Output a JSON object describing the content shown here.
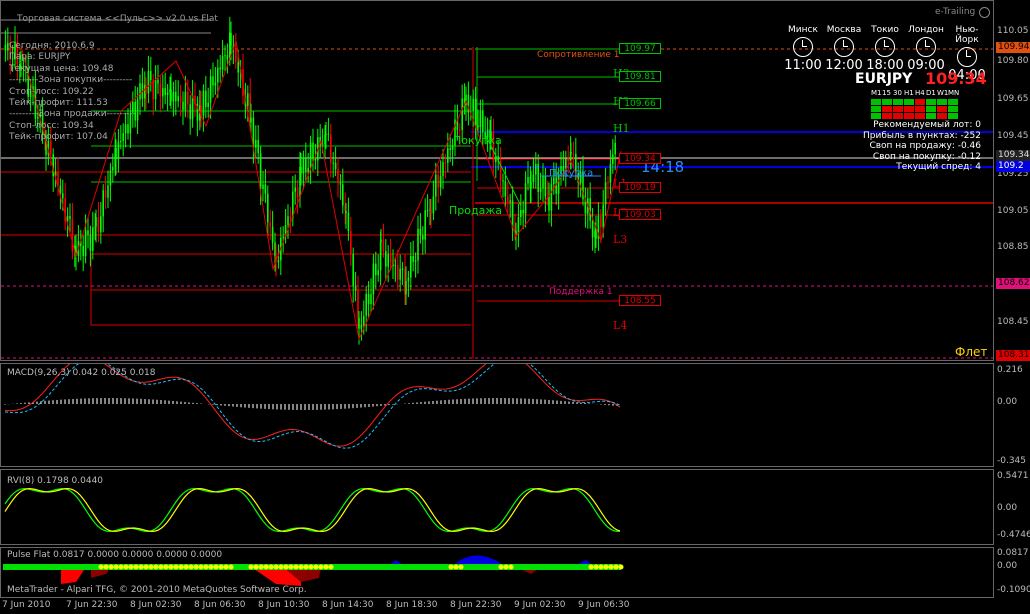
{
  "window": {
    "title": "Торговая система <<Пульс>> v2.0 vs Flat",
    "corner_label": "e-Trailing"
  },
  "info_lines": [
    "Сегодня: 2010.6.9",
    "Пара:  EURJPY",
    "Текущая цена: 109.48",
    "---------Зона покупки---------",
    "Стоп-лосс:     109.22",
    "Тейк-профит:   111.53",
    "---------Зона продажи---------",
    "Стоп-лосс:     109.34",
    "Тейк-профит:   107.04"
  ],
  "clocks": [
    {
      "city": "Минск",
      "time": "11:00"
    },
    {
      "city": "Москва",
      "time": "12:00"
    },
    {
      "city": "Токио",
      "time": "18:00"
    },
    {
      "city": "Лондон",
      "time": "09:00"
    },
    {
      "city": "Нью-Йорк",
      "time": "04:00"
    }
  ],
  "symbol": {
    "name": "EURJPY",
    "price": "109.34"
  },
  "timeframes": [
    "M1",
    "15",
    "30",
    "H1",
    "H4",
    "D1",
    "W1",
    "MN"
  ],
  "tf_status": [
    [
      "#00c000",
      "#00c000",
      "#00c000",
      "#00c000",
      "#e00000",
      "#00c000",
      "#00c000",
      "#00c000"
    ],
    [
      "#00c000",
      "#e00000",
      "#e00000",
      "#e00000",
      "#e00000",
      "#00c000",
      "#e00000",
      "#00c000"
    ],
    [
      "#00c000",
      "#e00000",
      "#e00000",
      "#e00000",
      "#e00000",
      "#00c000",
      "#e00000",
      "#00c000"
    ]
  ],
  "stats": [
    "Рекомендуемый лот: 0",
    "Прибыль в пунктах: -252",
    "Своп на продажу: -0.46",
    "Своп на покупку: -0.12",
    "Текущий спред: 4"
  ],
  "levels": [
    {
      "label": "H3",
      "price": "109.97",
      "color": "#00c000"
    },
    {
      "label": "H2",
      "price": "109.81",
      "color": "#00c000"
    },
    {
      "label": "H1",
      "price": "109.66",
      "color": "#00c000"
    },
    {
      "label": "L1",
      "price": "109.34",
      "color": "#e00000"
    },
    {
      "label": "L2",
      "price": "109.19",
      "color": "#e00000"
    },
    {
      "label": "L3",
      "price": "109.03",
      "color": "#e00000"
    },
    {
      "label": "L4",
      "price": "108.55",
      "color": "#e00000"
    }
  ],
  "zone_labels": {
    "resistance": "Сопротивление 1",
    "support": "Поддержка 1",
    "sell": "Продажа",
    "buy": "Покупка",
    "buy2": "Покупка",
    "flat": "Флет",
    "countdown": "14:18"
  },
  "price_axis": [
    "110.05",
    "109.80",
    "109.65",
    "109.45",
    "109.25",
    "109.05",
    "108.85",
    "108.65",
    "108.45"
  ],
  "price_tags": [
    {
      "value": "109.94",
      "bg": "#e05010",
      "fg": "#000"
    },
    {
      "value": "109.34",
      "bg": "#222",
      "fg": "#ddd"
    },
    {
      "value": "109.2",
      "bg": "#0000e0",
      "fg": "#fff"
    },
    {
      "value": "108.62",
      "bg": "#e0107a",
      "fg": "#000"
    },
    {
      "value": "108.31",
      "bg": "#e00000",
      "fg": "#000"
    }
  ],
  "macd": {
    "title": "MACD(9,26,3) 0.042 0.025 0.018",
    "axis": [
      "0.216",
      "0.00",
      "-0.345"
    ]
  },
  "rvi": {
    "title": "RVI(8) 0.1798 0.0440",
    "axis": [
      "0.5471",
      "0.00",
      "-0.4746"
    ]
  },
  "pulse": {
    "title": "Pulse Flat 0.0817 0.0000 0.0000 0.0000 0.0000",
    "axis": [
      "0.0817",
      "0.00",
      "-0.1090"
    ]
  },
  "footer": "MetaTrader - Alpari TFG, © 2001-2010 MetaQuotes Software Corp.",
  "time_axis": [
    "7 Jun 2010",
    "7 Jun 22:30",
    "8 Jun 02:30",
    "8 Jun 06:30",
    "8 Jun 10:30",
    "8 Jun 14:30",
    "8 Jun 18:30",
    "8 Jun 22:30",
    "9 Jun 02:30",
    "9 Jun 06:30"
  ],
  "colors": {
    "bull": "#00ff00",
    "bear": "#ff0000",
    "level_green": "#00c000",
    "level_red": "#e00000",
    "resistance": "#e05010",
    "support": "#e0107a",
    "blue_line": "#0000e0"
  }
}
